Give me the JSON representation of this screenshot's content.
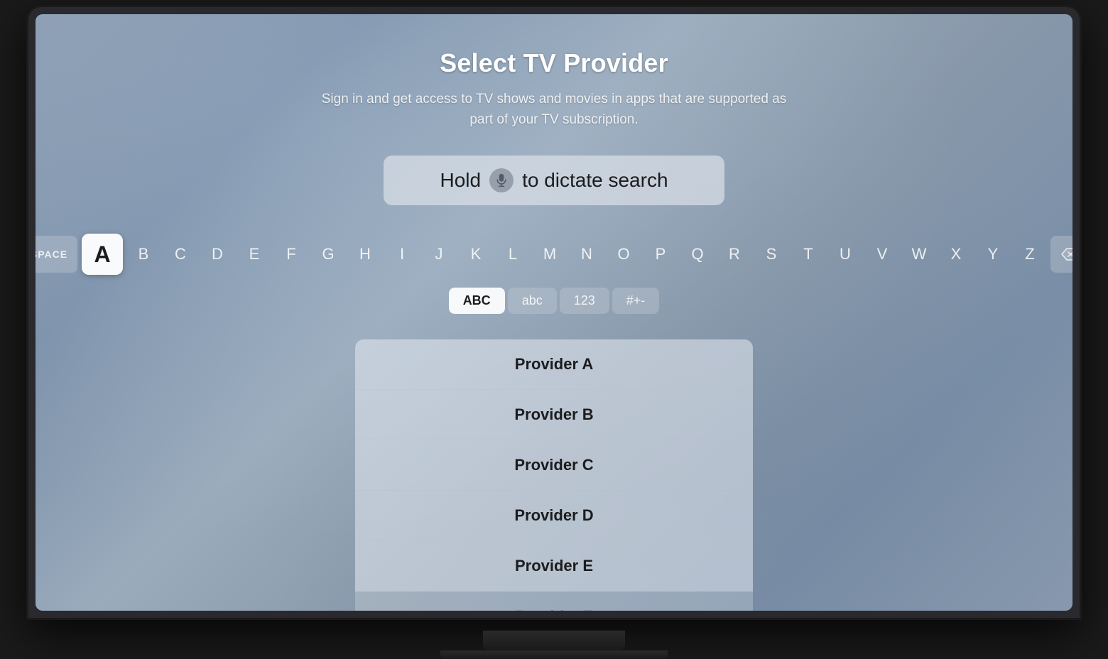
{
  "page": {
    "title": "Select TV Provider",
    "subtitle": "Sign in and get access to TV shows and movies in apps that are supported as part of your TV subscription."
  },
  "dictate_bar": {
    "text_before": "Hold",
    "text_after": "to dictate search",
    "full_text": "Hold 🎤 to dictate search"
  },
  "keyboard": {
    "space_label": "SPACE",
    "letters": [
      "A",
      "B",
      "C",
      "D",
      "E",
      "F",
      "G",
      "H",
      "I",
      "J",
      "K",
      "L",
      "M",
      "N",
      "O",
      "P",
      "Q",
      "R",
      "S",
      "T",
      "U",
      "V",
      "W",
      "X",
      "Y",
      "Z"
    ],
    "active_key": "A",
    "modes": [
      {
        "label": "ABC",
        "active": true
      },
      {
        "label": "abc",
        "active": false
      },
      {
        "label": "123",
        "active": false
      },
      {
        "label": "#+-",
        "active": false
      }
    ]
  },
  "providers": [
    {
      "name": "Provider A"
    },
    {
      "name": "Provider B"
    },
    {
      "name": "Provider C"
    },
    {
      "name": "Provider D"
    },
    {
      "name": "Provider E"
    },
    {
      "name": "Provider F",
      "faded": true
    }
  ]
}
